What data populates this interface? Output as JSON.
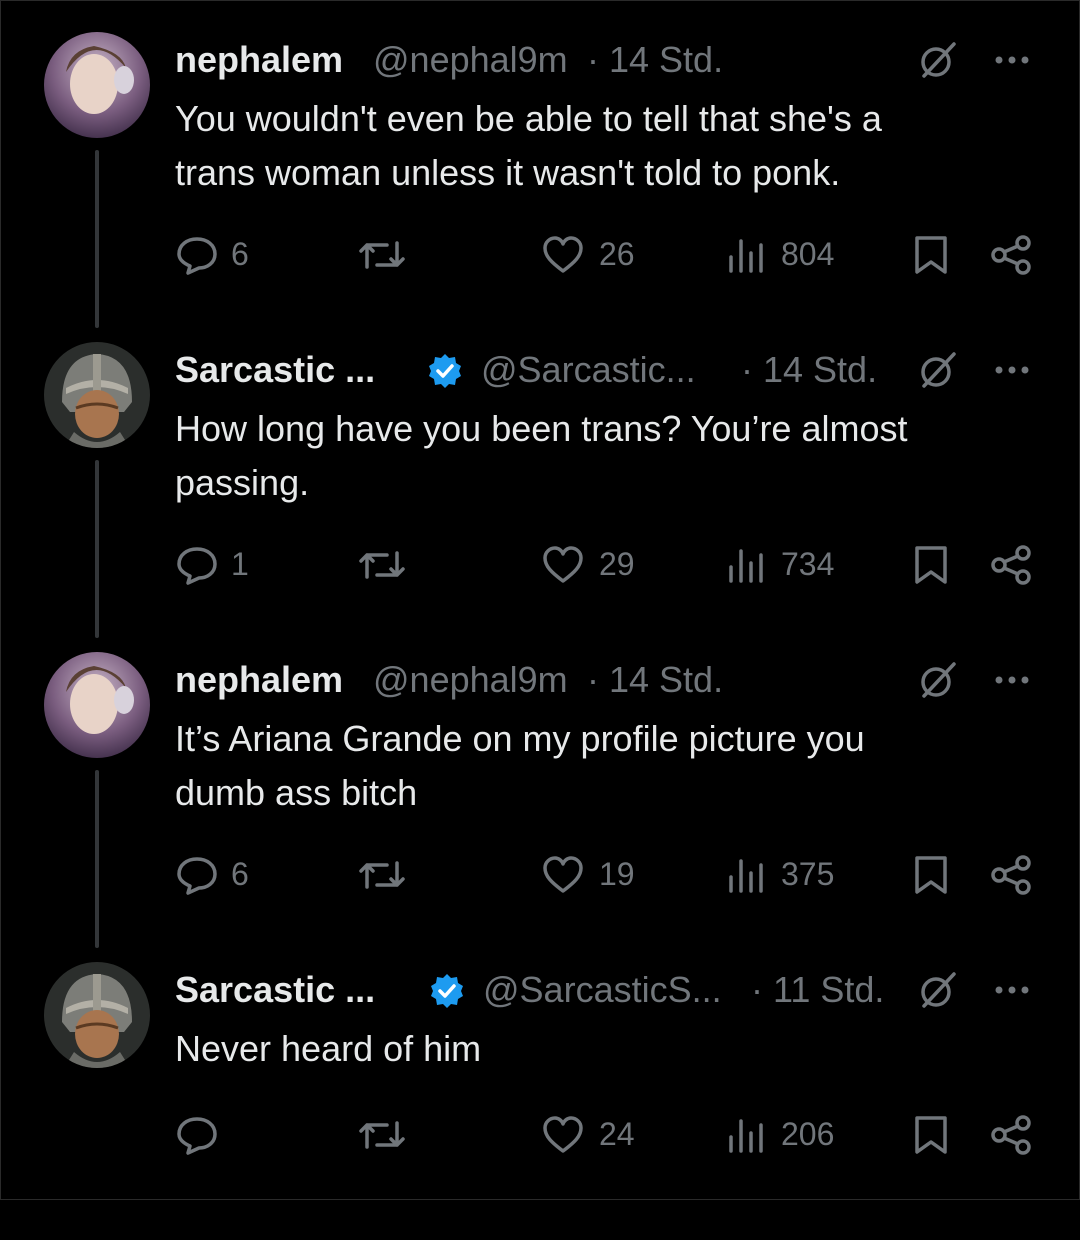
{
  "colors": {
    "background": "#000000",
    "text": "#e7e9ea",
    "muted": "#71767b",
    "verified_blue": "#1d9bf0",
    "thread_line": "#333639"
  },
  "tweets": [
    {
      "name": "nephalem",
      "handle": "@nephal9m",
      "time": "· 14 Std.",
      "verified": false,
      "text_lines": [
        "You wouldn't even be able to tell that she's a",
        "trans woman unless it wasn't told to ponk."
      ],
      "replies": "6",
      "likes": "26",
      "views": "804"
    },
    {
      "name": "Sarcastic ...",
      "handle": "@Sarcastic...",
      "time": "· 14 Std.",
      "verified": true,
      "text_lines": [
        "How long have you been trans?  You’re almost",
        "passing."
      ],
      "replies": "1",
      "likes": "29",
      "views": "734"
    },
    {
      "name": "nephalem",
      "handle": "@nephal9m",
      "time": "· 14 Std.",
      "verified": false,
      "text_lines": [
        "It’s Ariana Grande on my profile picture you",
        "dumb ass bitch"
      ],
      "replies": "6",
      "likes": "19",
      "views": "375"
    },
    {
      "name": "Sarcastic ...",
      "handle": "@SarcasticS...",
      "time": "· 11 Std.",
      "verified": true,
      "text_lines": [
        "Never heard of him"
      ],
      "replies": "",
      "likes": "24",
      "views": "206"
    }
  ],
  "icons": {
    "reply": "reply-bubble-icon",
    "retweet": "retweet-icon",
    "like": "heart-icon",
    "views": "views-bar-chart-icon",
    "bookmark": "bookmark-icon",
    "share": "share-icon",
    "grok": "grok-slash-circle-icon",
    "more": "more-dots-icon",
    "verified": "verified-badge-icon"
  }
}
